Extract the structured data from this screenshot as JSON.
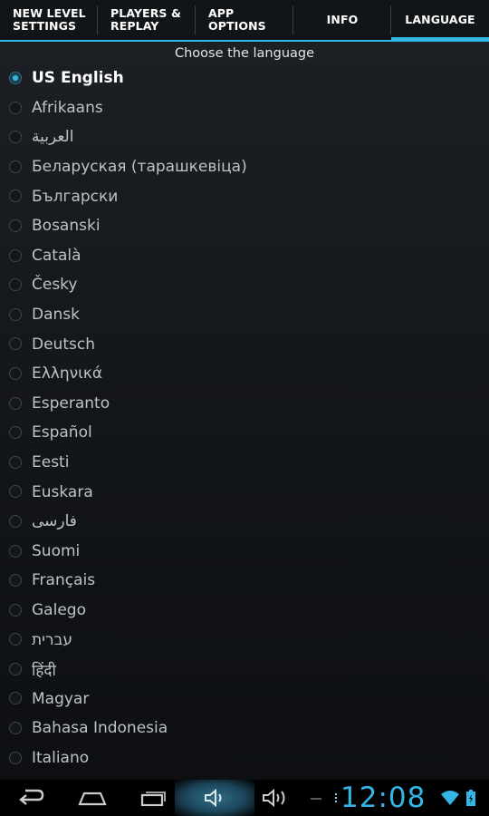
{
  "tabs": [
    {
      "label": "NEW LEVEL SETTINGS",
      "line1": "NEW LEVEL",
      "line2": "SETTINGS",
      "active": false
    },
    {
      "label": "PLAYERS & REPLAY",
      "line1": "PLAYERS &",
      "line2": "REPLAY",
      "active": false
    },
    {
      "label": "APP OPTIONS",
      "line1": "APP",
      "line2": "OPTIONS",
      "active": false
    },
    {
      "label": "INFO",
      "active": false
    },
    {
      "label": "LANGUAGE",
      "active": true
    }
  ],
  "caption": "Choose the language",
  "languages": [
    {
      "label": "US English",
      "selected": true
    },
    {
      "label": "Afrikaans",
      "selected": false
    },
    {
      "label": "العربية",
      "selected": false
    },
    {
      "label": "Беларуская (тарашкевіца)",
      "selected": false
    },
    {
      "label": "Български",
      "selected": false
    },
    {
      "label": "Bosanski",
      "selected": false
    },
    {
      "label": "Català",
      "selected": false
    },
    {
      "label": "Česky",
      "selected": false
    },
    {
      "label": "Dansk",
      "selected": false
    },
    {
      "label": "Deutsch",
      "selected": false
    },
    {
      "label": "Ελληνικά",
      "selected": false
    },
    {
      "label": "Esperanto",
      "selected": false
    },
    {
      "label": "Español",
      "selected": false
    },
    {
      "label": "Eesti",
      "selected": false
    },
    {
      "label": "Euskara",
      "selected": false
    },
    {
      "label": "فارسی",
      "selected": false
    },
    {
      "label": "Suomi",
      "selected": false
    },
    {
      "label": "Français",
      "selected": false
    },
    {
      "label": "Galego",
      "selected": false
    },
    {
      "label": "עברית",
      "selected": false
    },
    {
      "label": "हिंदी",
      "selected": false
    },
    {
      "label": "Magyar",
      "selected": false
    },
    {
      "label": "Bahasa Indonesia",
      "selected": false
    },
    {
      "label": "Italiano",
      "selected": false
    }
  ],
  "navbar": {
    "icons": [
      "back-icon",
      "home-icon",
      "recent-apps-icon",
      "volume-down-icon",
      "volume-up-icon",
      "notification-dots-icon",
      "wifi-icon",
      "battery-icon"
    ],
    "time": "12:08"
  },
  "colors": {
    "accent": "#33b5e5",
    "background": "#15181c"
  }
}
